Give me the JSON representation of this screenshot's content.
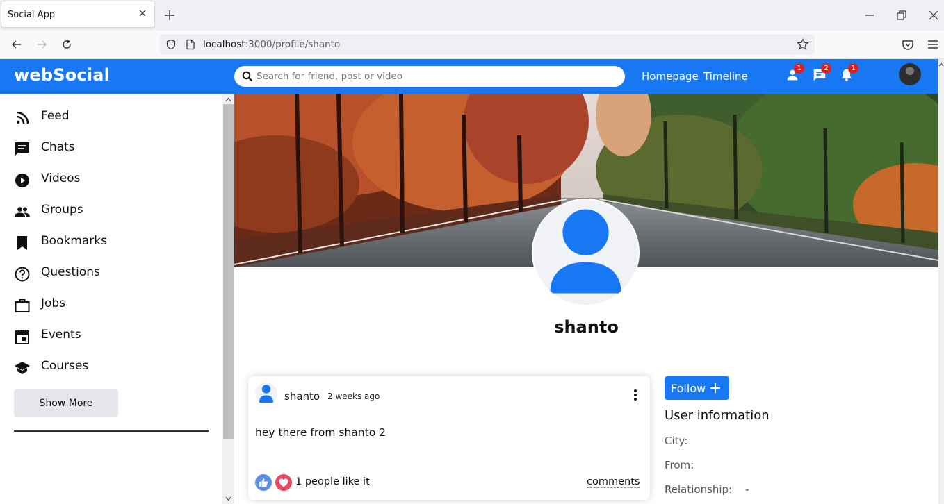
{
  "browser": {
    "tab_title": "Social App",
    "url_host": "localhost",
    "url_rest": ":3000/profile/shanto"
  },
  "app": {
    "logo": "webSocial",
    "search_placeholder": "Search for friend, post or video",
    "links": [
      "Homepage",
      "Timeline"
    ],
    "badges": {
      "friends": "1",
      "messages": "2",
      "notifications": "1"
    },
    "accent_color": "#1877f2"
  },
  "sidebar": {
    "items": [
      {
        "label": "Feed",
        "icon": "rss-feed-icon"
      },
      {
        "label": "Chats",
        "icon": "chat-icon"
      },
      {
        "label": "Videos",
        "icon": "play-circle-icon"
      },
      {
        "label": "Groups",
        "icon": "group-icon"
      },
      {
        "label": "Bookmarks",
        "icon": "bookmark-icon"
      },
      {
        "label": "Questions",
        "icon": "help-outline-icon"
      },
      {
        "label": "Jobs",
        "icon": "work-outline-icon"
      },
      {
        "label": "Events",
        "icon": "event-icon"
      },
      {
        "label": "Courses",
        "icon": "school-icon"
      }
    ],
    "show_more": "Show More"
  },
  "profile": {
    "name": "shanto"
  },
  "post": {
    "user": "shanto",
    "date": "2 weeks ago",
    "text": "hey there from shanto 2",
    "likes": "1 people like it",
    "comments": "comments"
  },
  "user_info": {
    "follow": "Follow",
    "title": "User information",
    "city_label": "City:",
    "city": "",
    "from_label": "From:",
    "from": "",
    "relationship_label": "Relationship:",
    "relationship": "-"
  }
}
